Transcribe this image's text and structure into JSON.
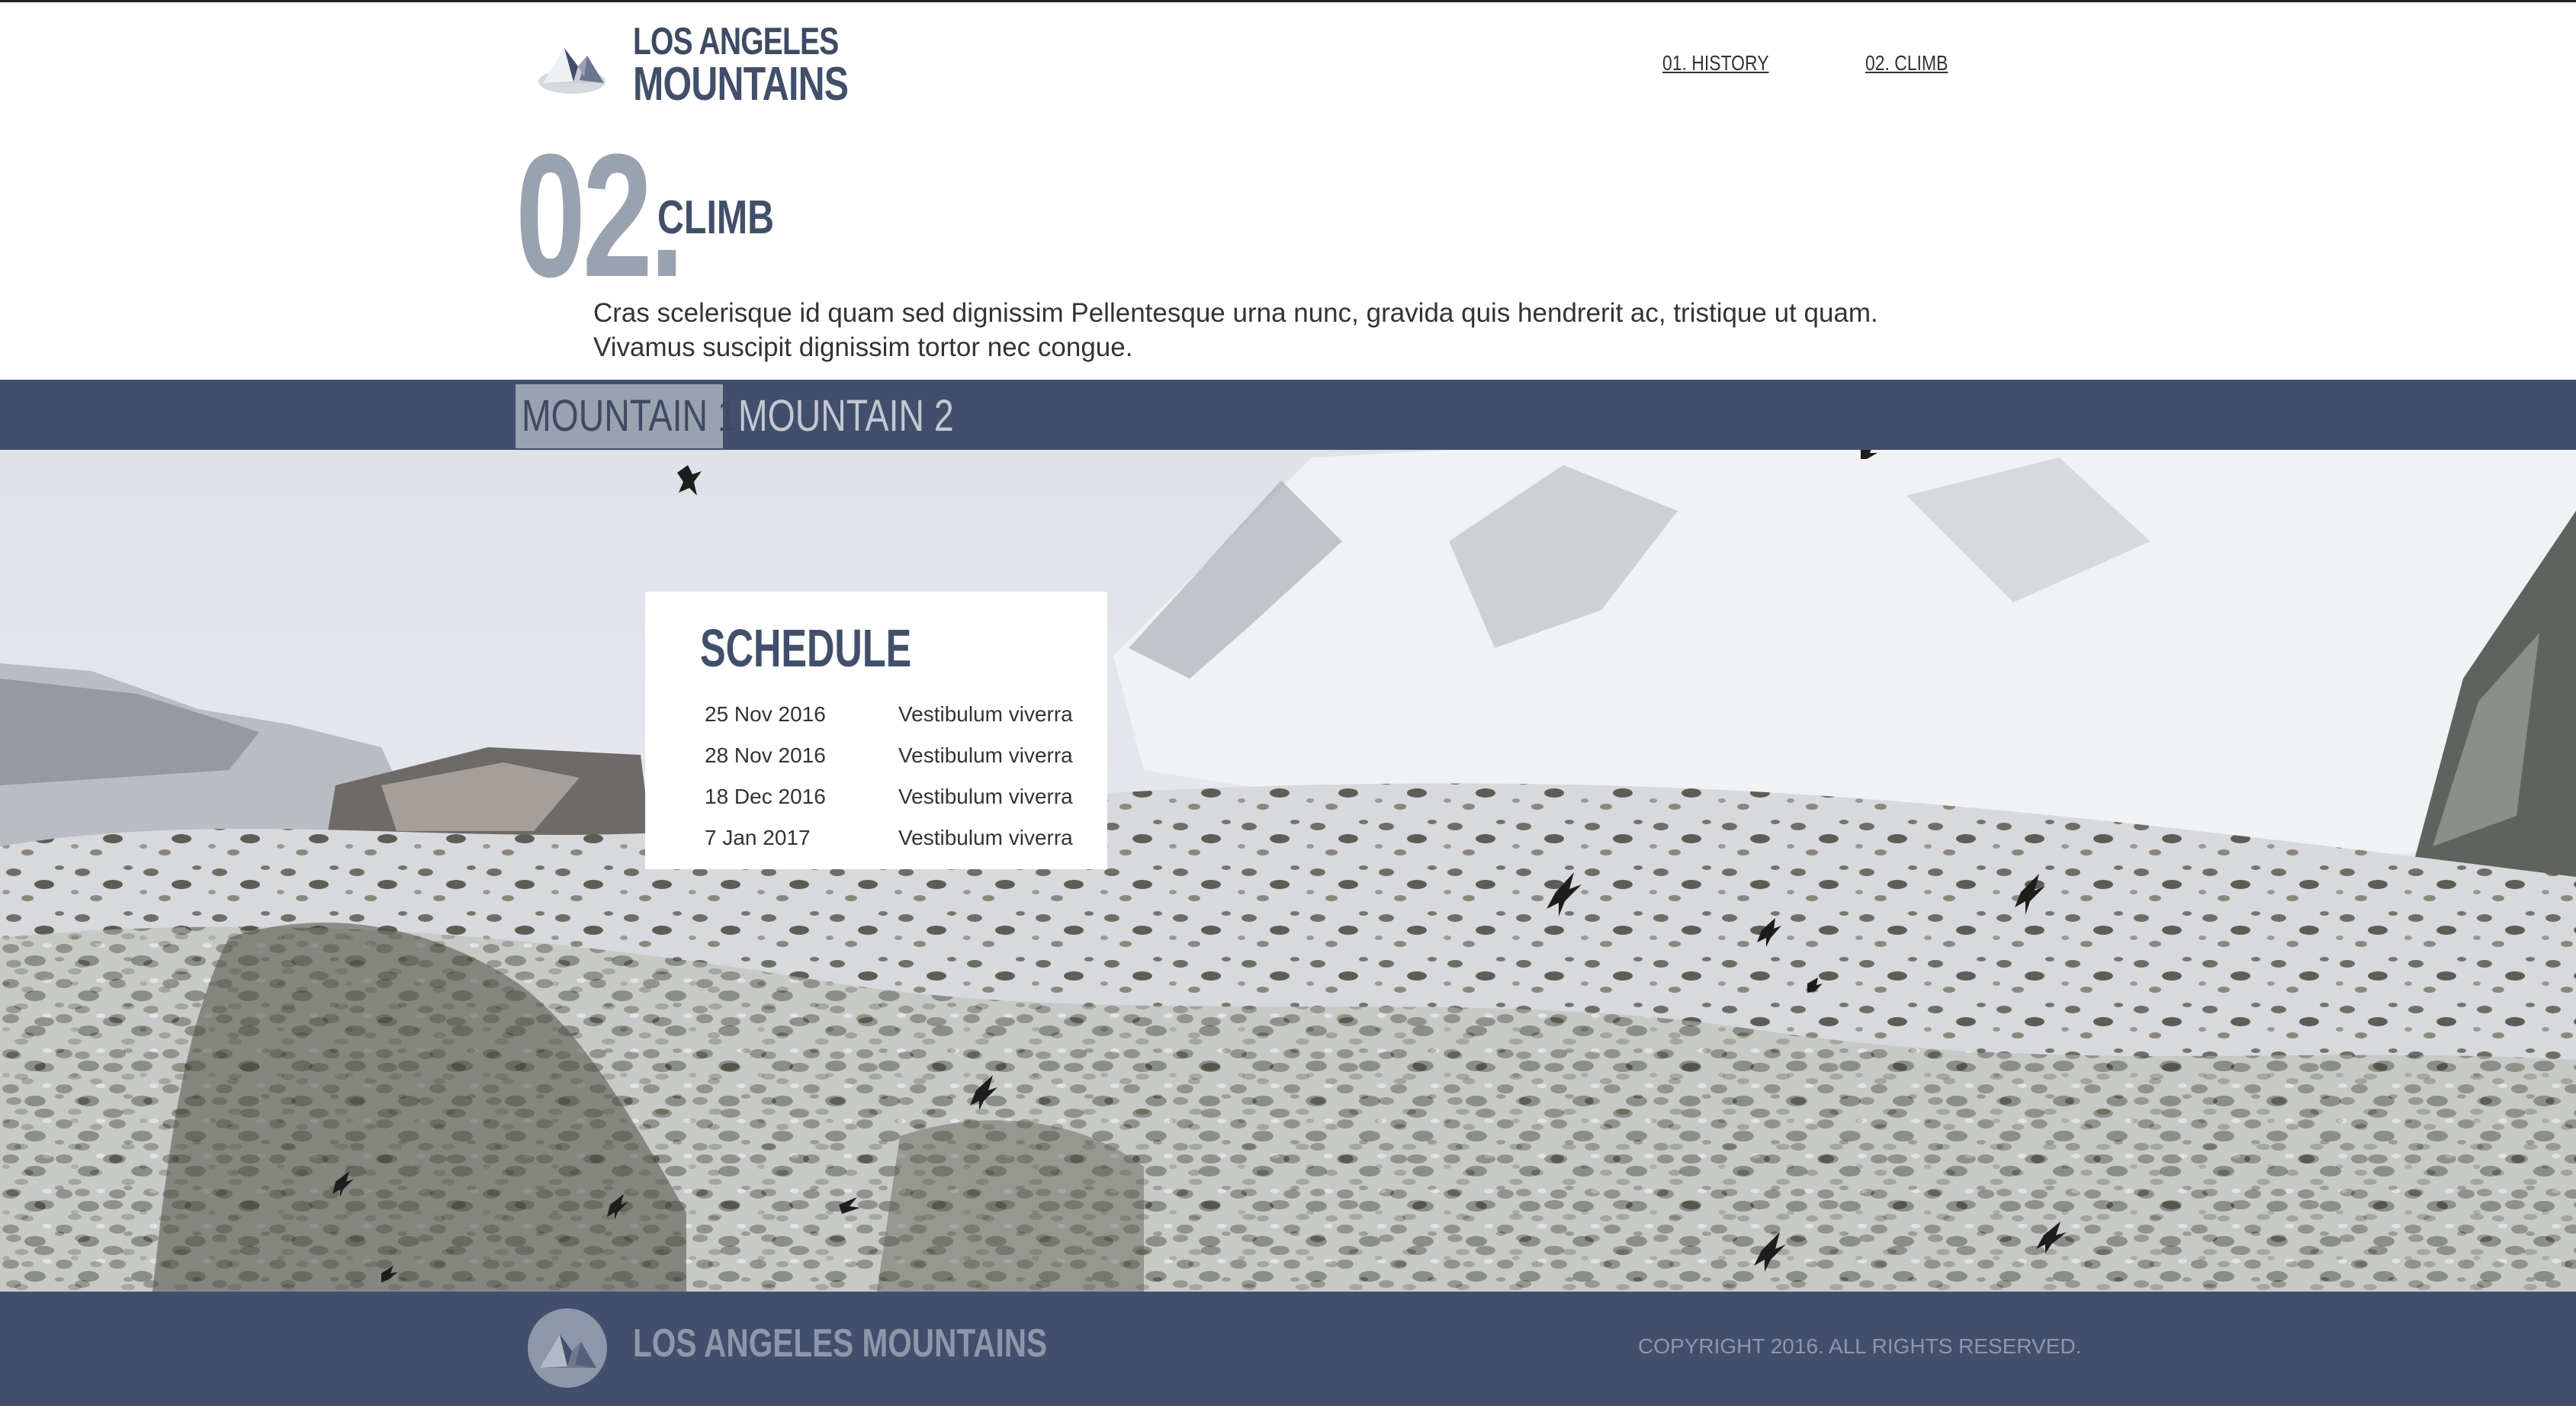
{
  "header": {
    "logo_line1": "LOS ANGELES",
    "logo_line2": "MOUNTAINS",
    "nav": [
      {
        "label": "01. HISTORY"
      },
      {
        "label": "02. CLIMB"
      }
    ]
  },
  "section": {
    "number": "02.",
    "title": "CLIMB",
    "description": "Cras scelerisque id quam sed dignissim Pellentesque urna nunc, gravida quis hendrerit ac, tristique ut quam. Vivamus suscipit dignissim tortor nec congue."
  },
  "tabs": [
    {
      "label": "MOUNTAIN 1",
      "active": true
    },
    {
      "label": "MOUNTAIN 2",
      "active": false
    }
  ],
  "schedule": {
    "title": "SCHEDULE",
    "rows": [
      {
        "date": "25 Nov 2016",
        "desc": "Vestibulum viverra"
      },
      {
        "date": "28 Nov 2016",
        "desc": "Vestibulum viverra"
      },
      {
        "date": "18 Dec 2016",
        "desc": "Vestibulum viverra"
      },
      {
        "date": "7 Jan 2017",
        "desc": "Vestibulum viverra"
      }
    ]
  },
  "footer": {
    "name": "LOS ANGELES MOUNTAINS",
    "copyright": "COPYRIGHT 2016. ALL RIGHTS RESERVED."
  },
  "colors": {
    "brand_navy": "#414f6c",
    "muted_gray": "#9aa1b0",
    "footer_text": "#8e97a9"
  },
  "icons": {
    "logo": "mountain-logo-icon",
    "hero": "snowy-mountain-photo"
  }
}
